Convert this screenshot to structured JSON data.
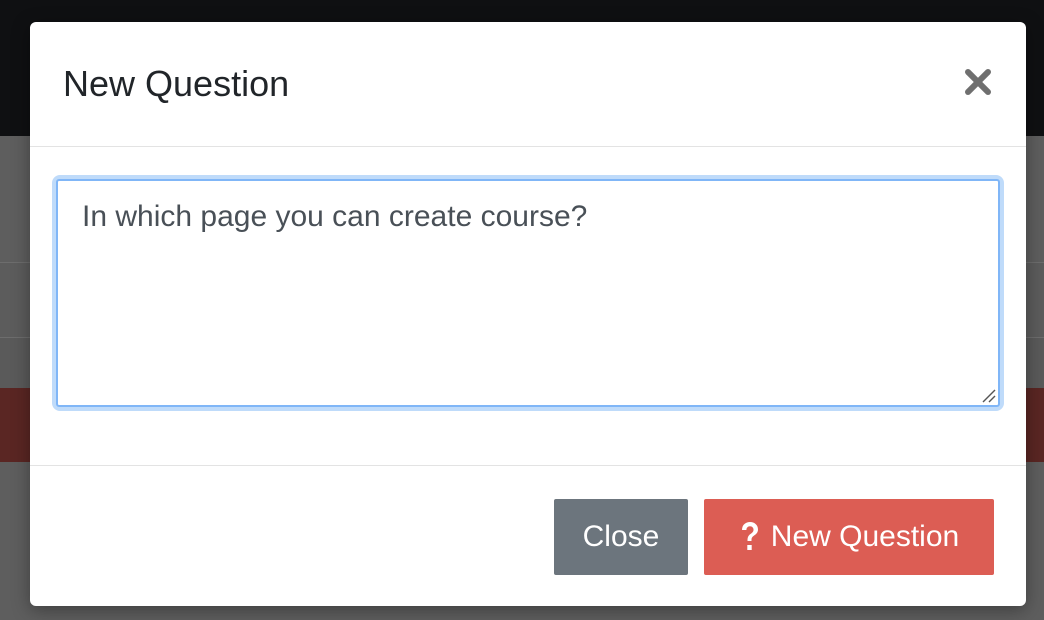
{
  "modal": {
    "title": "New Question",
    "question_value": "In which page you can create course?",
    "close_label": "Close",
    "submit_label": "New Question"
  },
  "icons": {
    "dismiss": "close-icon",
    "submit": "question-mark-icon",
    "resize": "resize-handle-icon"
  },
  "colors": {
    "close_button": "#6c757d",
    "submit_button": "#dc5d54",
    "focus_ring": "#bfdbfa"
  }
}
